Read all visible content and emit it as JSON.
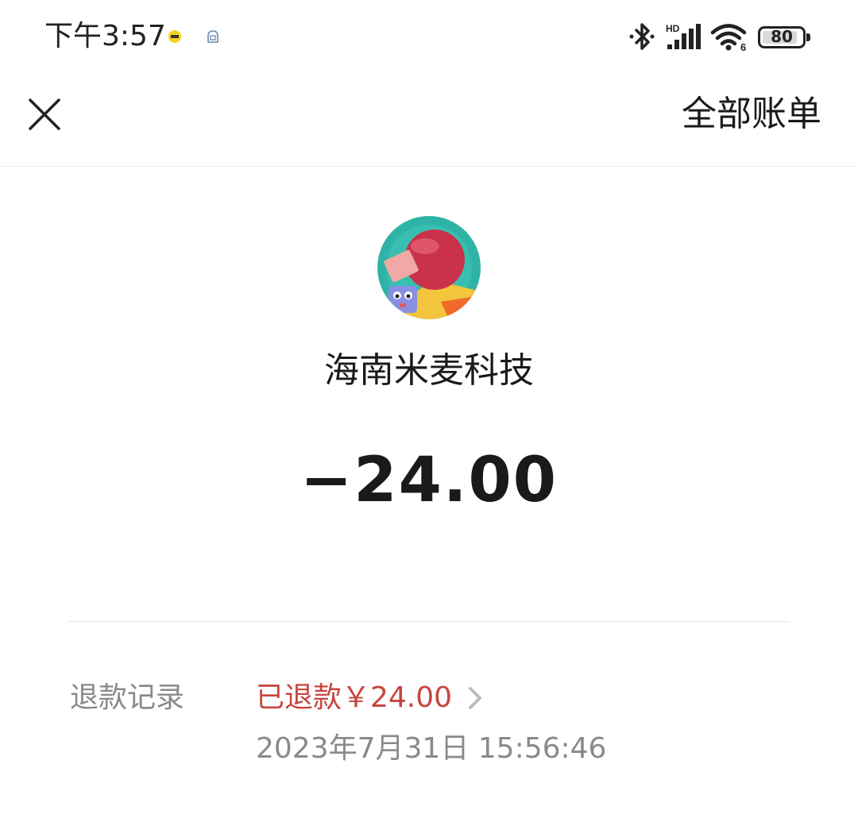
{
  "status_bar": {
    "time": "下午3:57",
    "battery": "80",
    "icons": [
      "notification-icon",
      "cloud-icon",
      "bluetooth-icon",
      "signal-hd-icon",
      "wifi-6-icon",
      "battery-icon"
    ]
  },
  "nav": {
    "close_icon": "close-icon",
    "all_bills_label": "全部账单"
  },
  "merchant": {
    "name": "海南米麦科技",
    "avatar_icon": "merchant-avatar"
  },
  "transaction": {
    "amount": "−24.00"
  },
  "refund": {
    "label": "退款记录",
    "status": "已退款￥24.00",
    "time": "2023年7月31日 15:56:46"
  },
  "colors": {
    "refund_red": "#c8453e",
    "label_gray": "#8a8a8a",
    "text_dark": "#1a1a1a"
  }
}
